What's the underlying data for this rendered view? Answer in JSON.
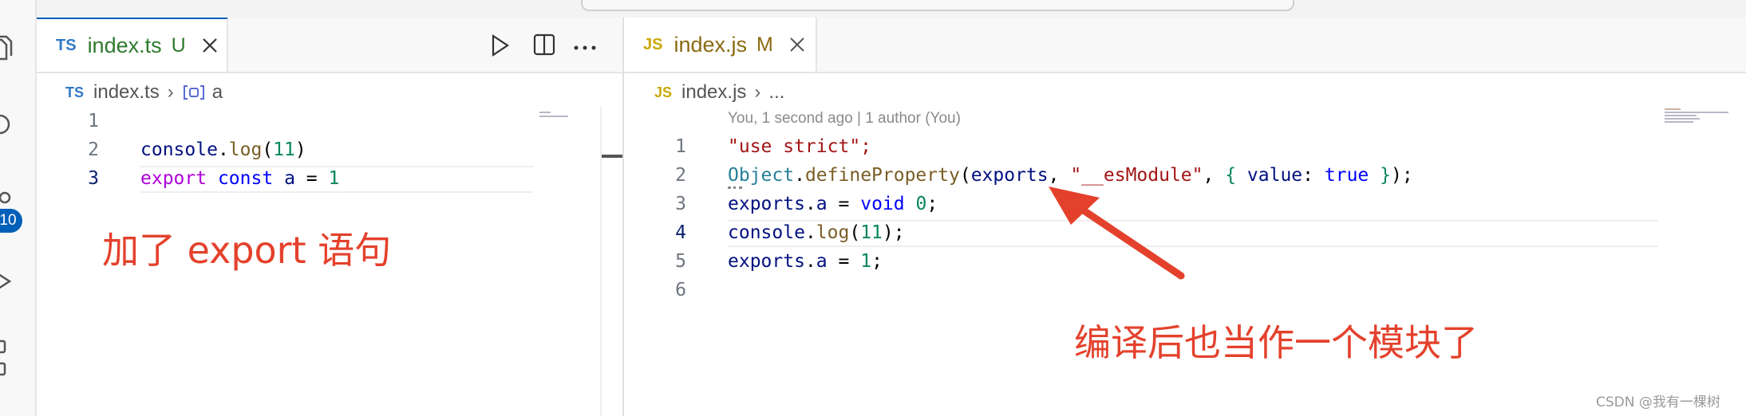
{
  "left_editor": {
    "tab": {
      "lang": "TS",
      "filename": "index.ts",
      "status": "U"
    },
    "breadcrumb": {
      "lang": "TS",
      "file": "index.ts",
      "symbol": "a"
    },
    "line_numbers": [
      "1",
      "2",
      "3"
    ],
    "code": {
      "line2": {
        "obj": "console",
        "dot": ".",
        "method": "log",
        "open": "(",
        "arg": "11",
        "close": ")"
      },
      "line3": {
        "kw1": "export",
        "kw2": "const",
        "name": "a",
        "eq": "=",
        "val": "1"
      }
    }
  },
  "right_editor": {
    "tab": {
      "lang": "JS",
      "filename": "index.js",
      "status": "M"
    },
    "breadcrumb": {
      "lang": "JS",
      "file": "index.js",
      "rest": "..."
    },
    "blame": "You, 1 second ago | 1 author (You)",
    "line_numbers": [
      "1",
      "2",
      "3",
      "4",
      "5",
      "6"
    ],
    "code": {
      "line1": "\"use strict\";",
      "line2": {
        "obj": "Object",
        "method": "defineProperty",
        "arg1": "exports",
        "arg2": "\"__esModule\"",
        "prop": "value",
        "val": "true"
      },
      "line3": {
        "obj": "exports",
        "prop": "a",
        "eq": "=",
        "kw": "void",
        "num": "0"
      },
      "line4": {
        "obj": "console",
        "method": "log",
        "num": "11"
      },
      "line5": {
        "obj": "exports",
        "prop": "a",
        "eq": "=",
        "num": "1"
      }
    }
  },
  "annotations": {
    "left": "加了 export 语句",
    "right": "编译后也当作一个模块了"
  },
  "activity_bar": {
    "scm_badge": "10"
  },
  "watermark": "CSDN @我有一棵树",
  "colors": {
    "annotation": "#e4412c",
    "accent": "#005fb8",
    "arrow": "#e4412c"
  }
}
